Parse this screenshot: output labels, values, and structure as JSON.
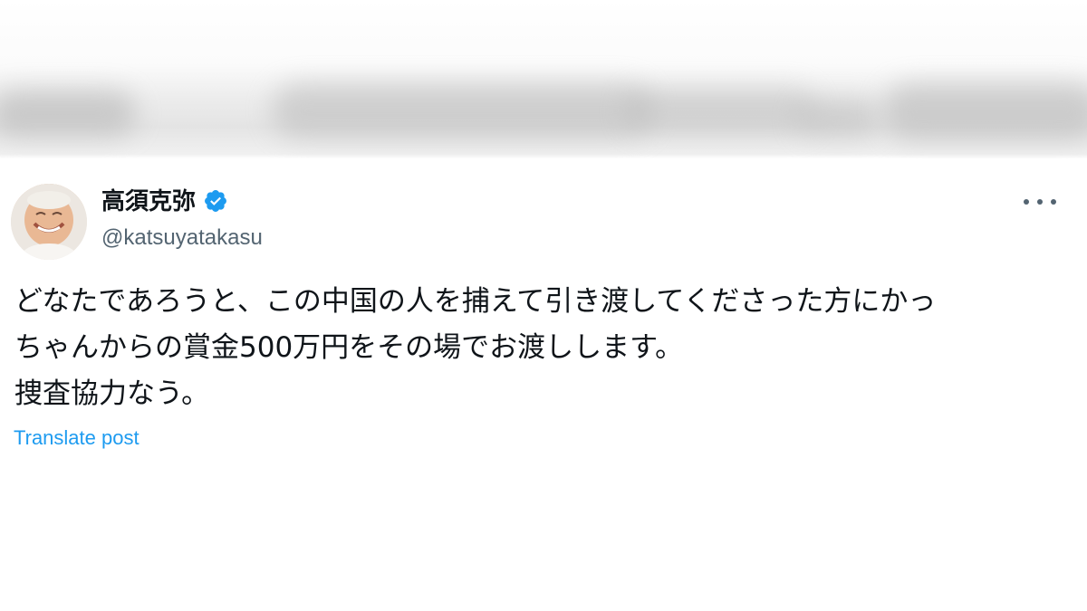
{
  "post": {
    "author_name": "高須克弥",
    "handle": "@katsuyatakasu",
    "verified": true,
    "avatar": "profile-photo",
    "more_icon": "more-horizontal-icon",
    "text_lines": [
      "どなたであろうと、この中国の人を捕えて引き渡してくださった方にかっ",
      "ちゃんからの賞金500万円をその場でお渡しします。",
      "捜査協力なう。"
    ],
    "translate_label": "Translate post"
  },
  "colors": {
    "text": "#0f1419",
    "secondary_text": "#536471",
    "accent": "#1d9bf0",
    "background": "#ffffff"
  }
}
